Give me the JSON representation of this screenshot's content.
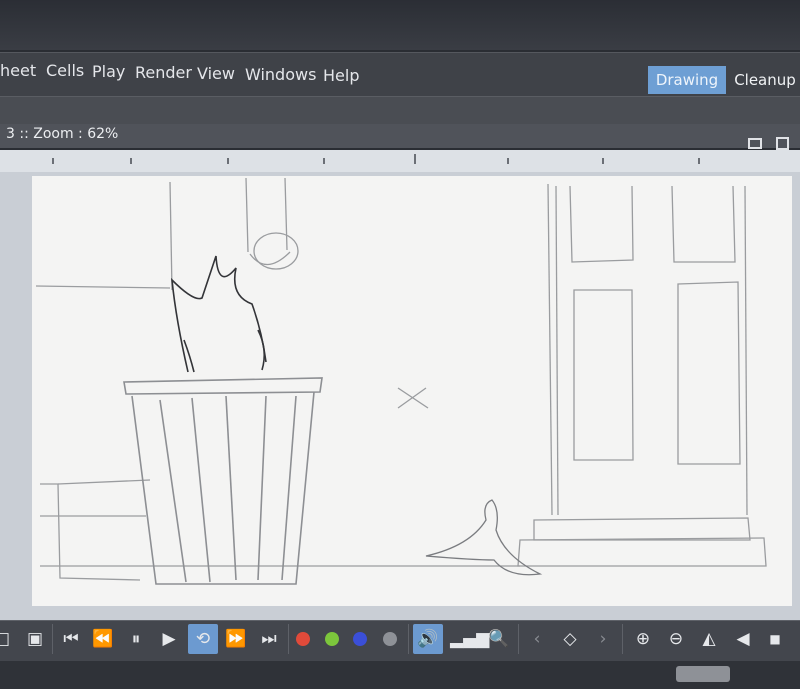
{
  "menu": {
    "items": [
      {
        "label": "heet",
        "icon": ""
      },
      {
        "label": "Cells",
        "icon": ""
      },
      {
        "label": "Play",
        "icon": ""
      },
      {
        "label": "Render",
        "icon": ""
      },
      {
        "label": "View",
        "icon": ""
      },
      {
        "label": "Windows",
        "icon": ""
      },
      {
        "label": "Help",
        "icon": ""
      }
    ]
  },
  "rooms": {
    "active_tab": "Drawing",
    "inactive_tab": "Cleanup",
    "accent_color": "#6e9fd4"
  },
  "viewer": {
    "title_prefix": "3 :: ",
    "zoom_text": "Zoom : 62%",
    "icons": [
      "single-view-icon",
      "grid-view-icon"
    ]
  },
  "playback": {
    "controls": [
      {
        "name": "first-frame-button",
        "glyph": "⏮",
        "active": false
      },
      {
        "name": "prev-frame-button",
        "glyph": "⏪",
        "active": false
      },
      {
        "name": "pause-button",
        "glyph": "⏸",
        "active": false
      },
      {
        "name": "play-button",
        "glyph": "▶",
        "active": false
      },
      {
        "name": "loop-button",
        "glyph": "⟲",
        "active": true
      },
      {
        "name": "next-frame-button",
        "glyph": "⏩",
        "active": false
      },
      {
        "name": "last-frame-button",
        "glyph": "⏭",
        "active": false
      }
    ],
    "channel_colors": [
      "#e04a3a",
      "#7cc63c",
      "#3b4fd8",
      "#8e9197"
    ],
    "sound_icon": "speaker-icon",
    "sound_active": true
  },
  "colors": {
    "accent": "#6e9fd4",
    "panel": "#43464d",
    "canvas": "#f4f4f3"
  }
}
